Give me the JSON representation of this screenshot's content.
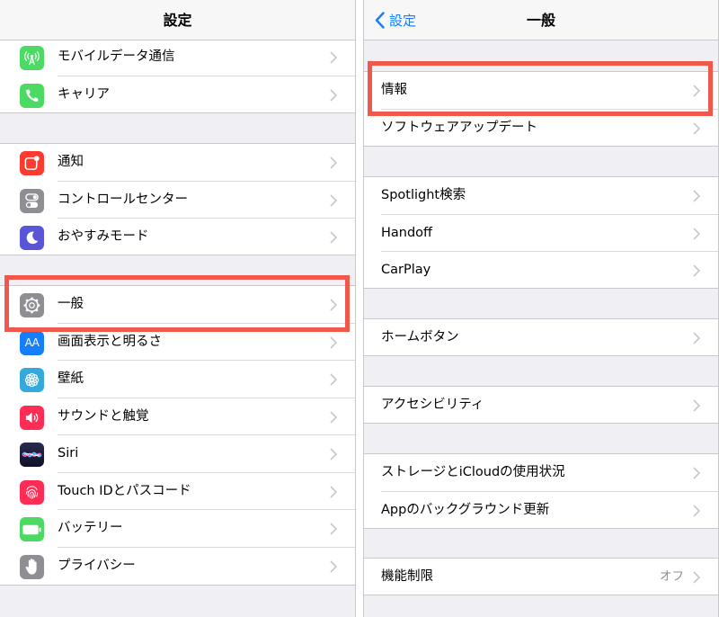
{
  "left": {
    "title": "設定",
    "items": [
      {
        "label": "モバイルデータ通信",
        "icon": "antenna-icon",
        "color": "#4cd964"
      },
      {
        "label": "キャリア",
        "icon": "phone-icon",
        "color": "#4cd964"
      },
      {
        "label": "通知",
        "icon": "notification-icon",
        "color": "#ff3b30"
      },
      {
        "label": "コントロールセンター",
        "icon": "toggles-icon",
        "color": "#8e8e93"
      },
      {
        "label": "おやすみモード",
        "icon": "moon-icon",
        "color": "#5856d6"
      },
      {
        "label": "一般",
        "icon": "gear-icon",
        "color": "#8e8e93"
      },
      {
        "label": "画面表示と明るさ",
        "icon": "text-size-icon",
        "color": "#147efb",
        "glyph": "AA"
      },
      {
        "label": "壁紙",
        "icon": "flower-icon",
        "color": "#34aadc"
      },
      {
        "label": "サウンドと触覚",
        "icon": "speaker-icon",
        "color": "#ff2d55"
      },
      {
        "label": "Siri",
        "icon": "siri-icon",
        "color": "#1c1c3c"
      },
      {
        "label": "Touch IDとパスコード",
        "icon": "fingerprint-icon",
        "color": "#ff2d55"
      },
      {
        "label": "バッテリー",
        "icon": "battery-icon",
        "color": "#4cd964"
      },
      {
        "label": "プライバシー",
        "icon": "hand-icon",
        "color": "#8e8e93"
      }
    ]
  },
  "right": {
    "title": "一般",
    "back_label": "設定",
    "items": [
      {
        "label": "情報"
      },
      {
        "label": "ソフトウェアアップデート"
      },
      {
        "label": "Spotlight検索"
      },
      {
        "label": "Handoff"
      },
      {
        "label": "CarPlay"
      },
      {
        "label": "ホームボタン"
      },
      {
        "label": "アクセシビリティ"
      },
      {
        "label": "ストレージとiCloudの使用状況"
      },
      {
        "label": "Appのバックグラウンド更新"
      },
      {
        "label": "機能制限",
        "value": "オフ"
      }
    ]
  },
  "colors": {
    "highlight": "#f0584b",
    "link": "#147efb",
    "chevron": "#c7c7cc"
  }
}
